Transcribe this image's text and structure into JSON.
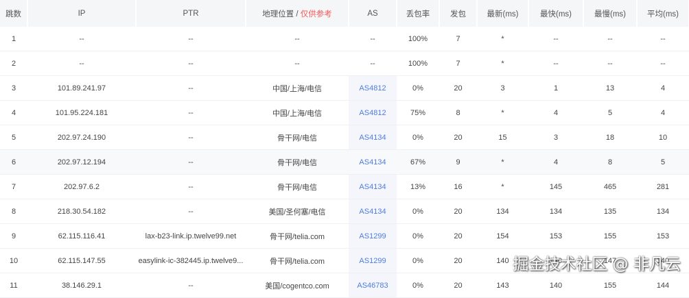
{
  "headers": {
    "hop": "跳数",
    "ip": "IP",
    "ptr": "PTR",
    "geo": "地理位置 / ",
    "geo_note": "仅供参考",
    "as": "AS",
    "loss": "丢包率",
    "sent": "发包",
    "last": "最新(ms)",
    "best": "最快(ms)",
    "worst": "最慢(ms)",
    "avg": "平均(ms)"
  },
  "rows": [
    [
      "1",
      "--",
      "--",
      "--",
      "--",
      "100%",
      "7",
      "*",
      "--",
      "--",
      "--"
    ],
    [
      "2",
      "--",
      "--",
      "--",
      "--",
      "100%",
      "7",
      "*",
      "--",
      "--",
      "--"
    ],
    [
      "3",
      "101.89.241.97",
      "--",
      "中国/上海/电信",
      "AS4812",
      "0%",
      "20",
      "3",
      "1",
      "13",
      "4"
    ],
    [
      "4",
      "101.95.224.181",
      "--",
      "中国/上海/电信",
      "AS4812",
      "75%",
      "8",
      "*",
      "4",
      "5",
      "4"
    ],
    [
      "5",
      "202.97.24.190",
      "--",
      "骨干网/电信",
      "AS4134",
      "0%",
      "20",
      "15",
      "3",
      "18",
      "10"
    ],
    [
      "6",
      "202.97.12.194",
      "--",
      "骨干网/电信",
      "AS4134",
      "67%",
      "9",
      "*",
      "4",
      "8",
      "5"
    ],
    [
      "7",
      "202.97.6.2",
      "--",
      "骨干网/电信",
      "AS4134",
      "13%",
      "16",
      "*",
      "145",
      "465",
      "281"
    ],
    [
      "8",
      "218.30.54.182",
      "--",
      "美国/圣何塞/电信",
      "AS4134",
      "0%",
      "20",
      "134",
      "134",
      "135",
      "134"
    ],
    [
      "9",
      "62.115.116.41",
      "lax-b23-link.ip.twelve99.net",
      "骨干网/telia.com",
      "AS1299",
      "0%",
      "20",
      "154",
      "153",
      "155",
      "153"
    ],
    [
      "10",
      "62.115.147.55",
      "easylink-ic-382445.ip.twelve9...",
      "骨干网/telia.com",
      "AS1299",
      "0%",
      "20",
      "140",
      "140",
      "147",
      "140"
    ],
    [
      "11",
      "38.146.29.1",
      "--",
      "美国/cogentco.com",
      "AS46783",
      "0%",
      "20",
      "143",
      "140",
      "155",
      "144"
    ]
  ],
  "watermark": "掘金技术社区 @ 非凡云"
}
